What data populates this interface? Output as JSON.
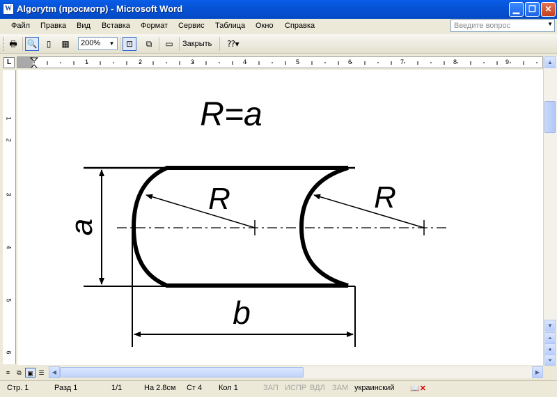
{
  "window": {
    "title": "Algorytm (просмотр) - Microsoft Word",
    "icon_letter": "W",
    "controls": [
      "minimize-icon",
      "maximize-icon",
      "close-icon"
    ]
  },
  "menu": {
    "items": [
      "Файл",
      "Правка",
      "Вид",
      "Вставка",
      "Формат",
      "Сервис",
      "Таблица",
      "Окно",
      "Справка"
    ],
    "help_placeholder": "Введите вопрос"
  },
  "toolbar": {
    "zoom": "200%",
    "close_label": "Закрыть",
    "buttons": [
      "print-icon",
      "magnifier-icon",
      "one-page-icon",
      "multiple-pages-icon",
      "view-ruler-icon",
      "shrink-to-fit-icon",
      "full-screen-icon",
      "context-help-icon"
    ]
  },
  "ruler": {
    "h_numbers": [
      "1",
      "1",
      "2",
      "3",
      "4",
      "5",
      "6",
      "7",
      "8",
      "9"
    ],
    "v_numbers": [
      "1",
      "2",
      "3",
      "4",
      "5",
      "6"
    ]
  },
  "drawing": {
    "title": "R=a",
    "label_r1": "R",
    "label_r2": "R",
    "label_a": "a",
    "label_b": "b"
  },
  "status": {
    "page": "Стр. 1",
    "section": "Разд 1",
    "pages": "1/1",
    "at": "На 2.8см",
    "line": "Ст 4",
    "col": "Кол 1",
    "rec": "ЗАП",
    "trk": "ИСПР",
    "ext": "ВДЛ",
    "ovr": "ЗАМ",
    "language": "украинский",
    "spell_icon": "spelling-check-icon"
  },
  "colors": {
    "titlebar": "#0753d6",
    "chrome": "#ece9d8",
    "page": "#ffffff"
  }
}
